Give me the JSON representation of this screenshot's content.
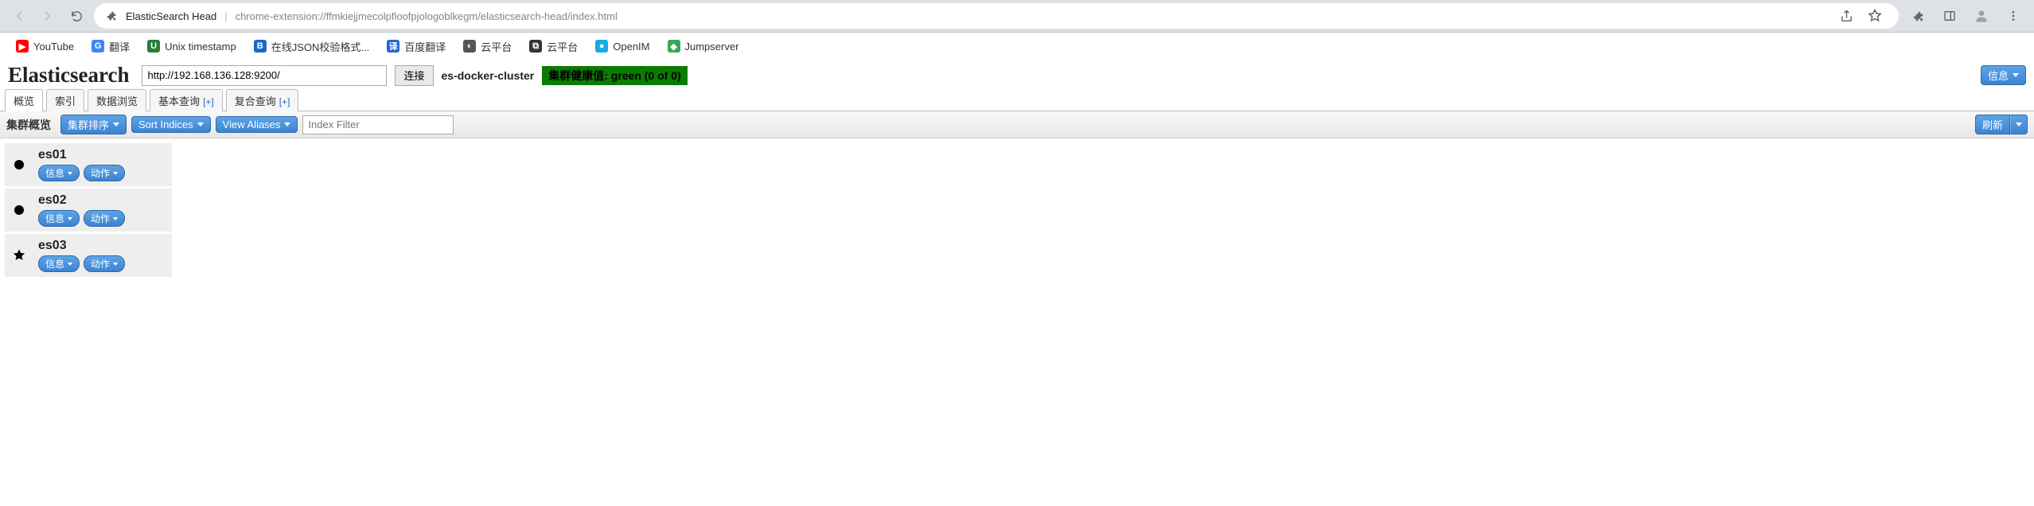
{
  "browser": {
    "page_title": "ElasticSearch Head",
    "url": "chrome-extension://ffmkiejjmecolpfloofpjologoblkegm/elasticsearch-head/index.html"
  },
  "bookmarks": [
    {
      "label": "YouTube",
      "icon_bg": "#ff0000",
      "icon_fg": "#fff",
      "icon_text": "▶"
    },
    {
      "label": "翻译",
      "icon_bg": "#4285f4",
      "icon_fg": "#fff",
      "icon_text": "G"
    },
    {
      "label": "Unix timestamp",
      "icon_bg": "#2a7d3a",
      "icon_fg": "#fff",
      "icon_text": "U"
    },
    {
      "label": "在线JSON校验格式...",
      "icon_bg": "#1b6ac9",
      "icon_fg": "#fff",
      "icon_text": "B"
    },
    {
      "label": "百度翻译",
      "icon_bg": "#2066d8",
      "icon_fg": "#fff",
      "icon_text": "译"
    },
    {
      "label": "云平台",
      "icon_bg": "#555",
      "icon_fg": "#fff",
      "icon_text": "◐"
    },
    {
      "label": "云平台",
      "icon_bg": "#333",
      "icon_fg": "#fff",
      "icon_text": "⧉"
    },
    {
      "label": "OpenIM",
      "icon_bg": "#18a8ea",
      "icon_fg": "#fff",
      "icon_text": "●"
    },
    {
      "label": "Jumpserver",
      "icon_bg": "#3aa655",
      "icon_fg": "#fff",
      "icon_text": "◆"
    }
  ],
  "app": {
    "title": "Elasticsearch",
    "url_value": "http://192.168.136.128:9200/",
    "connect_label": "连接",
    "cluster_name": "es-docker-cluster",
    "health_text": "集群健康值: green (0 of 0)",
    "info_label": "信息"
  },
  "tabs": [
    {
      "label": "概览",
      "plus": false,
      "active": true
    },
    {
      "label": "索引",
      "plus": false,
      "active": false
    },
    {
      "label": "数据浏览",
      "plus": false,
      "active": false
    },
    {
      "label": "基本查询",
      "plus": true,
      "active": false
    },
    {
      "label": "复合查询",
      "plus": true,
      "active": false
    }
  ],
  "overview": {
    "section_label": "集群概览",
    "cluster_sort_label": "集群排序",
    "sort_indices_label": "Sort Indices",
    "view_aliases_label": "View Aliases",
    "index_filter_placeholder": "Index Filter",
    "refresh_label": "刷新"
  },
  "nodes": [
    {
      "name": "es01",
      "master": false,
      "info_label": "信息",
      "action_label": "动作"
    },
    {
      "name": "es02",
      "master": false,
      "info_label": "信息",
      "action_label": "动作"
    },
    {
      "name": "es03",
      "master": true,
      "info_label": "信息",
      "action_label": "动作"
    }
  ]
}
